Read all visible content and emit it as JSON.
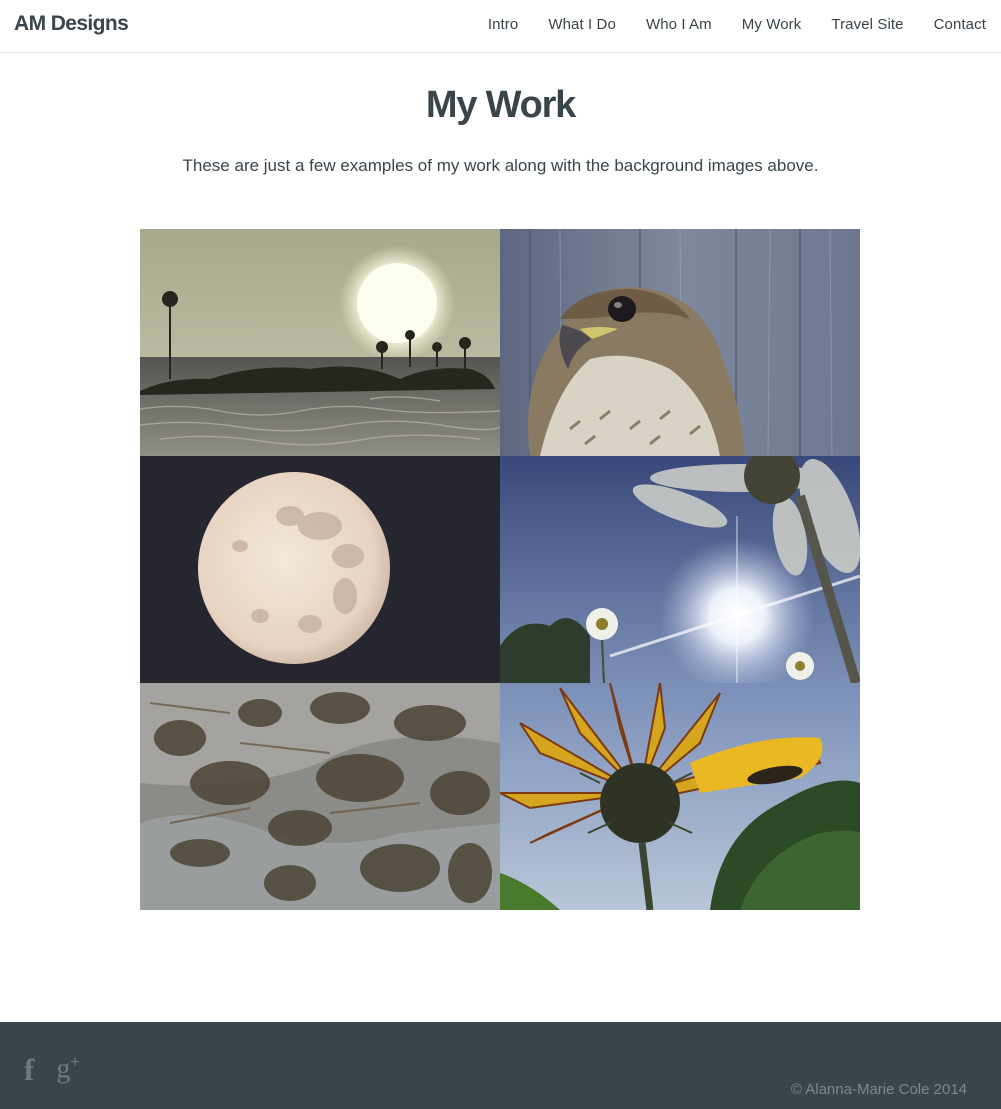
{
  "header": {
    "brand": "AM Designs",
    "nav": [
      "Intro",
      "What I Do",
      "Who I Am",
      "My Work",
      "Travel Site",
      "Contact"
    ]
  },
  "main": {
    "title": "My Work",
    "intro": "These are just a few examples of my work along with the background images above.",
    "gallery": [
      {
        "subject": "sunset-palm-island"
      },
      {
        "subject": "hawk-portrait"
      },
      {
        "subject": "full-moon"
      },
      {
        "subject": "daisy-sun-sky"
      },
      {
        "subject": "pine-cones-ground"
      },
      {
        "subject": "yellow-flower-caterpillar"
      }
    ]
  },
  "footer": {
    "social": {
      "facebook": "f",
      "google_plus": "g",
      "google_plus_sup": "+"
    },
    "copyright": "© Alanna-Marie Cole 2014"
  },
  "colors": {
    "text": "#39454b",
    "footer_bg": "#39454b",
    "footer_icon": "#6c7a81"
  }
}
